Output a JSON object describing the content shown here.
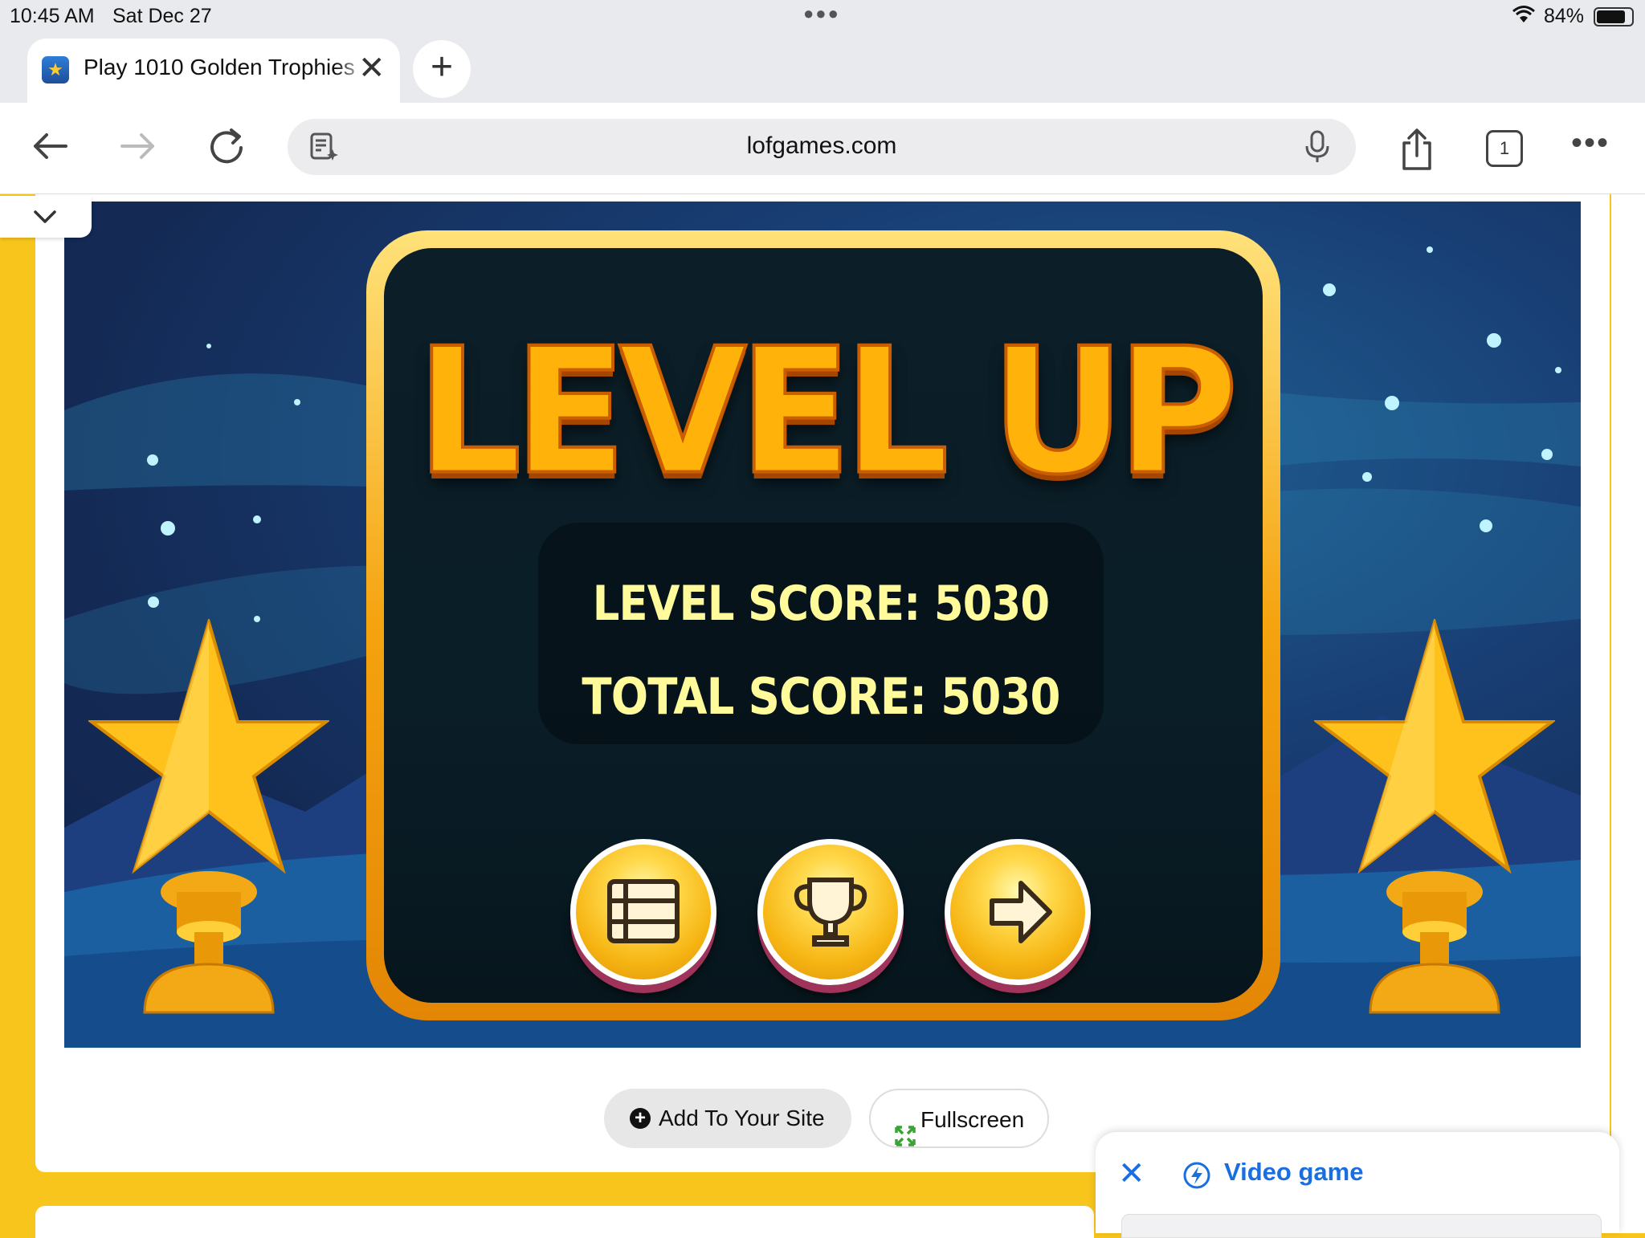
{
  "status_bar": {
    "time": "10:45 AM",
    "date": "Sat Dec 27",
    "battery_percent": "84%",
    "battery_level": 0.84
  },
  "browser": {
    "tab_title": "Play 1010 Golden Trophies",
    "url": "lofgames.com",
    "tab_count": "1",
    "icons": [
      "back-icon",
      "forward-icon",
      "reload-icon",
      "reader-icon",
      "mic-icon",
      "share-icon",
      "tabs-icon",
      "more-icon"
    ]
  },
  "game": {
    "title": "LEVEL UP",
    "level_score_label": "LEVEL SCORE: 5030",
    "total_score_label": "TOTAL SCORE: 5030",
    "buttons": [
      "menu-icon",
      "trophy-icon",
      "next-arrow-icon"
    ],
    "colors": {
      "panel": "#f5a30f",
      "title": "#ffb20a",
      "score_text": "#fffb9a"
    }
  },
  "page_actions": {
    "add_to_site": "Add To Your Site",
    "fullscreen": "Fullscreen"
  },
  "popup": {
    "label": "Video game"
  }
}
